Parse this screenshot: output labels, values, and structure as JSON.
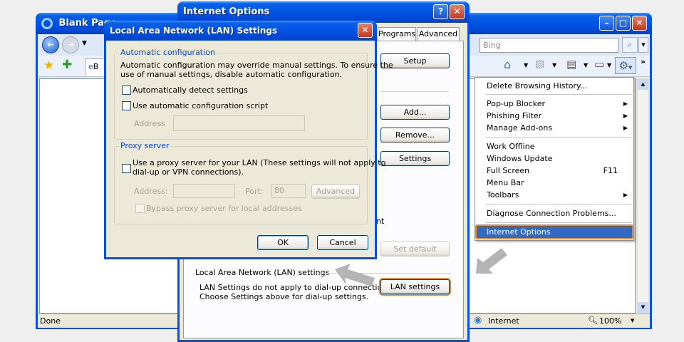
{
  "browser": {
    "title": "Blank Page",
    "search_placeholder": "Bing",
    "tab_label": "B",
    "status_done": "Done",
    "status_zone": "Internet",
    "zoom": "100%"
  },
  "tools_menu": {
    "items": [
      {
        "label": "Delete Browsing History..."
      },
      {
        "label": "Pop-up Blocker",
        "arrow": "▶"
      },
      {
        "label": "Phishing Filter",
        "arrow": "▶"
      },
      {
        "label": "Manage Add-ons",
        "arrow": "▶"
      },
      {
        "label": "Work Offline"
      },
      {
        "label": "Windows Update"
      },
      {
        "label": "Full Screen",
        "shortcut": "F11"
      },
      {
        "label": "Menu Bar"
      },
      {
        "label": "Toolbars",
        "arrow": "▶"
      },
      {
        "label": "Diagnose Connection Problems..."
      },
      {
        "label": "Internet Options"
      }
    ]
  },
  "internet_options": {
    "title": "Internet Options",
    "tabs": [
      "Programs",
      "Advanced"
    ],
    "setup_button": "Setup",
    "add_button": "Add...",
    "remove_button": "Remove...",
    "settings_button": "Settings",
    "partial_text": "nt",
    "set_default_button": "Set default",
    "lan_group_title": "Local Area Network (LAN) settings",
    "lan_text_1": "LAN Settings do not apply to dial-up connections.",
    "lan_text_2": "Choose Settings above for dial-up settings.",
    "lan_settings_button": "LAN settings"
  },
  "lan_dialog": {
    "title": "Local Area Network (LAN) Settings",
    "auto_config": {
      "legend": "Automatic configuration",
      "description_1": "Automatic configuration may override manual settings.  To ensure the",
      "description_2": "use of manual settings, disable automatic configuration.",
      "detect_label": "Automatically detect settings",
      "detect_checked": false,
      "script_label": "Use automatic configuration script",
      "script_checked": false,
      "address_label": "Address",
      "address_value": ""
    },
    "proxy": {
      "legend": "Proxy server",
      "use_proxy_label_1": "Use a proxy server for your LAN (These settings will not apply to",
      "use_proxy_label_2": "dial-up or VPN connections).",
      "use_proxy_checked": false,
      "address_label": "Address:",
      "address_value": "",
      "port_label": "Port:",
      "port_value": "80",
      "advanced_button": "Advanced",
      "bypass_label": "Bypass proxy server for local addresses",
      "bypass_checked": false
    },
    "ok_button": "OK",
    "cancel_button": "Cancel"
  },
  "colors": {
    "title_blue": "#0055e5",
    "highlight_orange": "#f28a20",
    "menu_selection": "#316ac5",
    "arrow_gray": "#b4b4b4"
  }
}
